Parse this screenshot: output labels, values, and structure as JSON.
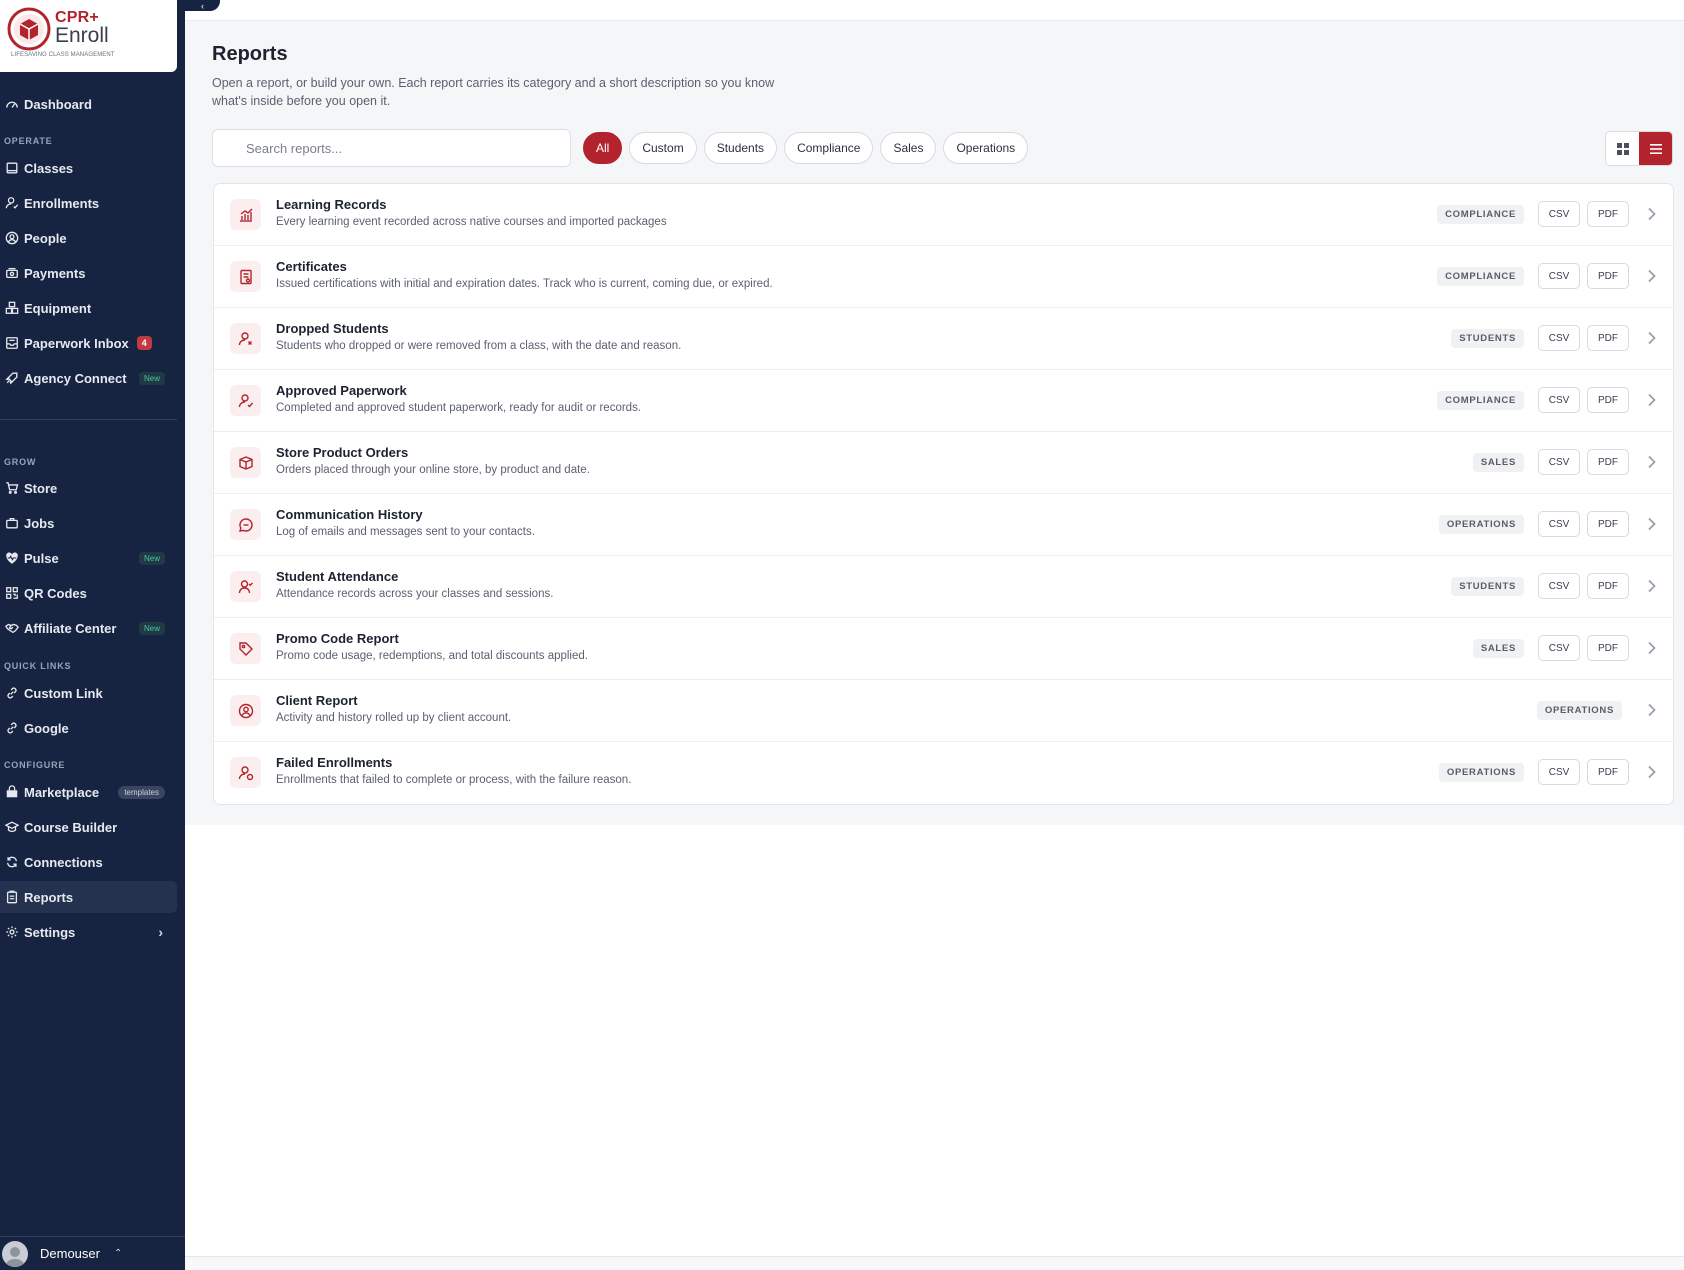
{
  "brand": {
    "cpr": "CPR+",
    "enroll": "Enroll",
    "tagline": "LIFESAVING CLASS MANAGEMENT"
  },
  "sidebar": {
    "dashboard": "Dashboard",
    "sections": {
      "operate": "OPERATE",
      "grow": "GROW",
      "quick_links": "QUICK LINKS",
      "configure": "CONFIGURE"
    },
    "operate": [
      {
        "label": "Classes",
        "icon": "book-icon"
      },
      {
        "label": "Enrollments",
        "icon": "user-check-icon"
      },
      {
        "label": "People",
        "icon": "user-circle-icon"
      },
      {
        "label": "Payments",
        "icon": "cash-icon"
      },
      {
        "label": "Equipment",
        "icon": "boxes-icon"
      },
      {
        "label": "Paperwork Inbox",
        "icon": "inbox-icon",
        "badge": "4"
      },
      {
        "label": "Agency Connect",
        "icon": "rocket-icon",
        "badge": "New"
      }
    ],
    "grow": [
      {
        "label": "Store",
        "icon": "cart-icon"
      },
      {
        "label": "Jobs",
        "icon": "briefcase-icon"
      },
      {
        "label": "Pulse",
        "icon": "heart-pulse-icon",
        "badge": "New"
      },
      {
        "label": "QR Codes",
        "icon": "qr-icon"
      },
      {
        "label": "Affiliate Center",
        "icon": "handshake-icon",
        "badge": "New"
      }
    ],
    "quick_links": [
      {
        "label": "Custom Link",
        "icon": "link-icon"
      },
      {
        "label": "Google",
        "icon": "link-icon"
      }
    ],
    "configure": [
      {
        "label": "Marketplace",
        "icon": "shop-icon",
        "badge": "templates"
      },
      {
        "label": "Course Builder",
        "icon": "graduation-icon"
      },
      {
        "label": "Connections",
        "icon": "refresh-icon"
      },
      {
        "label": "Reports",
        "icon": "clipboard-icon"
      },
      {
        "label": "Settings",
        "icon": "gear-icon"
      }
    ],
    "user": "Demouser"
  },
  "main": {
    "title": "Reports",
    "description": "Open a report, or build your own. Each report carries its category and a short description so you know what's inside before you open it.",
    "search_placeholder": "Search reports...",
    "filters": [
      "All",
      "Custom",
      "Students",
      "Compliance",
      "Sales",
      "Operations"
    ],
    "active_filter": "All",
    "view_mode": "list",
    "reports": [
      {
        "title": "Learning Records",
        "description": "Every learning event recorded across native courses and imported packages",
        "category": "COMPLIANCE",
        "csv": "CSV",
        "pdf": "PDF",
        "icon": "chart-icon"
      },
      {
        "title": "Certificates",
        "description": "Issued certifications with initial and expiration dates. Track who is current, coming due, or expired.",
        "category": "COMPLIANCE",
        "csv": "CSV",
        "pdf": "PDF",
        "icon": "certificate-icon"
      },
      {
        "title": "Dropped Students",
        "description": "Students who dropped or were removed from a class, with the date and reason.",
        "category": "STUDENTS",
        "csv": "CSV",
        "pdf": "PDF",
        "icon": "user-x-icon"
      },
      {
        "title": "Approved Paperwork",
        "description": "Completed and approved student paperwork, ready for audit or records.",
        "category": "COMPLIANCE",
        "csv": "CSV",
        "pdf": "PDF",
        "icon": "user-check-icon"
      },
      {
        "title": "Store Product Orders",
        "description": "Orders placed through your online store, by product and date.",
        "category": "SALES",
        "csv": "CSV",
        "pdf": "PDF",
        "icon": "package-icon"
      },
      {
        "title": "Communication History",
        "description": "Log of emails and messages sent to your contacts.",
        "category": "OPERATIONS",
        "csv": "CSV",
        "pdf": "PDF",
        "icon": "chat-icon"
      },
      {
        "title": "Student Attendance",
        "description": "Attendance records across your classes and sessions.",
        "category": "STUDENTS",
        "csv": "CSV",
        "pdf": "PDF",
        "icon": "user-attendance-icon"
      },
      {
        "title": "Promo Code Report",
        "description": "Promo code usage, redemptions, and total discounts applied.",
        "category": "SALES",
        "csv": "CSV",
        "pdf": "PDF",
        "icon": "tag-icon"
      },
      {
        "title": "Client Report",
        "description": "Activity and history rolled up by client account.",
        "category": "OPERATIONS",
        "csv": "",
        "pdf": "",
        "icon": "user-circle-icon"
      },
      {
        "title": "Failed Enrollments",
        "description": "Enrollments that failed to complete or process, with the failure reason.",
        "category": "OPERATIONS",
        "csv": "CSV",
        "pdf": "PDF",
        "icon": "user-alert-icon"
      }
    ]
  },
  "colors": {
    "accent": "#b3232e",
    "sidebar_bg": "#172441",
    "new_badge": "#4cc4a0"
  }
}
